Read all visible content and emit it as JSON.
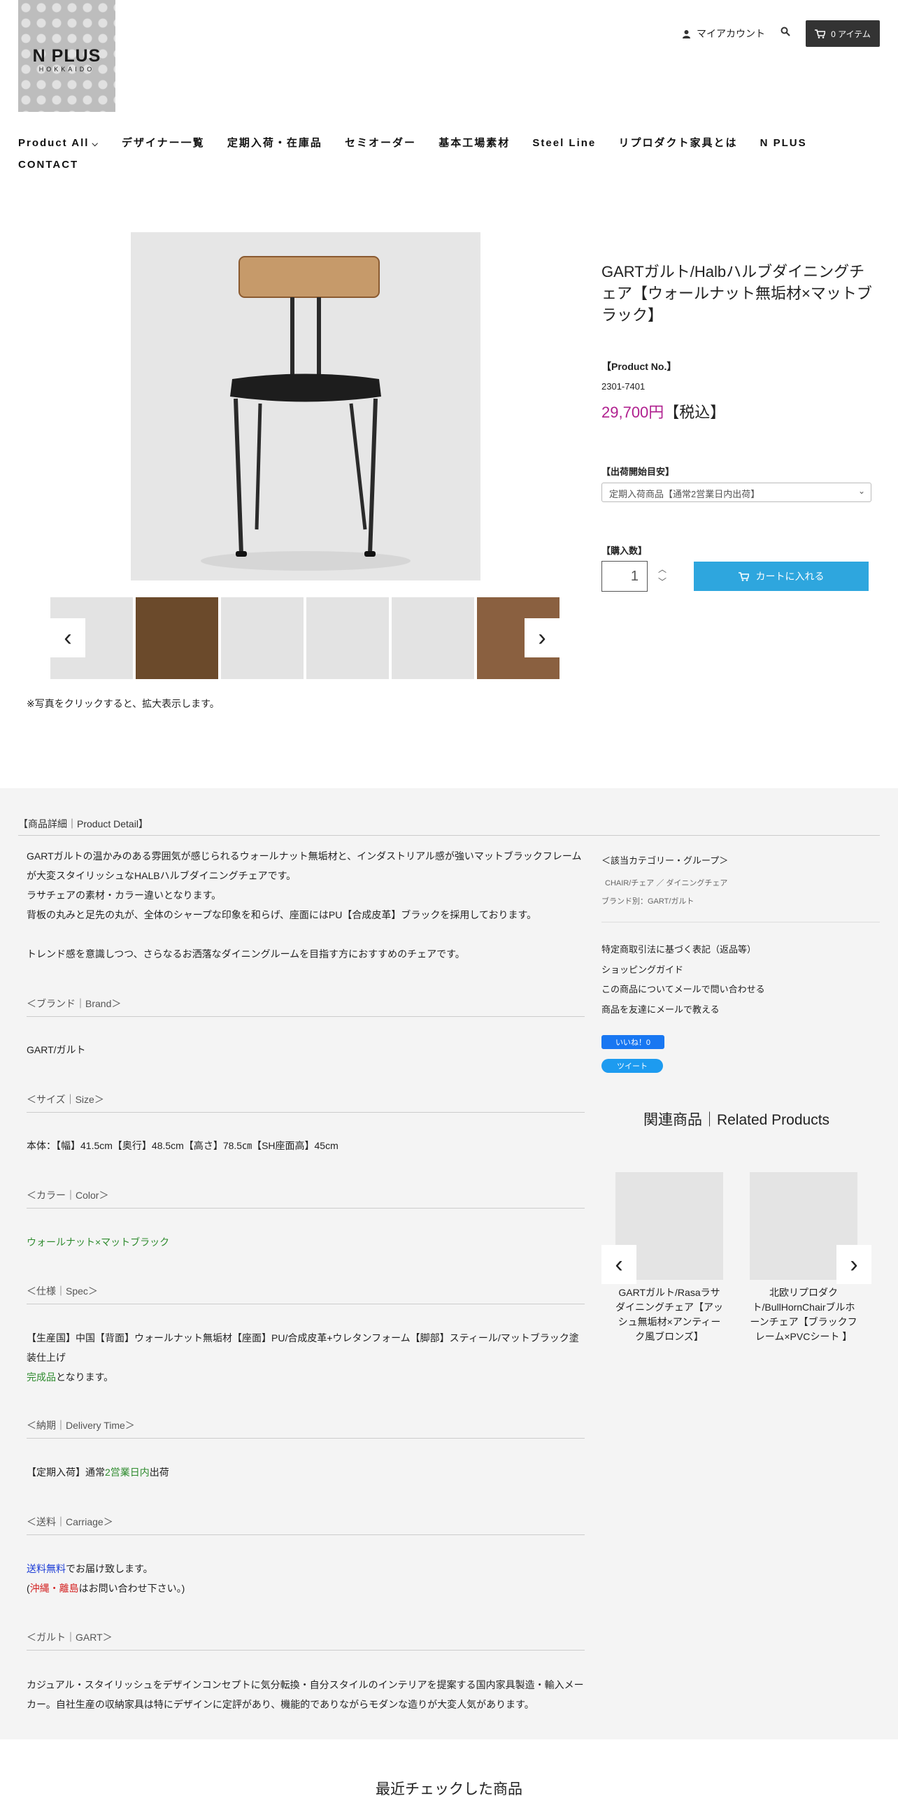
{
  "header": {
    "logo_text": "N PLUS",
    "logo_sub": "HOKKAIDO",
    "account_label": "マイアカウント",
    "cart_label": "0 アイテム"
  },
  "nav": {
    "items": [
      "Product All",
      "デザイナー一覧",
      "定期入荷・在庫品",
      "セミオーダー",
      "基本工場素材",
      "Steel Line",
      "リプロダクト家具とは",
      "N PLUS",
      "CONTACT"
    ]
  },
  "gallery": {
    "note": "※写真をクリックすると、拡大表示します。"
  },
  "product": {
    "title": "GARTガルト/Halbハルブダイニングチェア【ウォールナット無垢材×マットブラック】",
    "product_no_label": "【Product No.】",
    "product_no": "2301-7401",
    "price": "29,700円",
    "price_tax": "【税込】",
    "ship_label": "【出荷開始目安】",
    "ship_value": "定期入荷商品【通常2営業日内出荷】",
    "qty_label": "【購入数】",
    "qty_value": "1",
    "add_cart": "カートに入れる"
  },
  "detail": {
    "section_title": "【商品詳細｜Product Detail】",
    "intro": [
      "GARTガルトの温かみのある雰囲気が感じられるウォールナット無垢材と、インダストリアル感が強いマットブラックフレームが大変スタイリッシュなHALBハルブダイニングチェアです。",
      "ラサチェアの素材・カラー違いとなります。",
      "背板の丸みと足先の丸が、全体のシャープな印象を和らげ、座面にはPU【合成皮革】ブラックを採用しております。"
    ],
    "trend": "トレンド感を意識しつつ、さらなるお洒落なダイニングルームを目指す方におすすめのチェアです。",
    "brand_h": "＜ブランド｜Brand＞",
    "brand": "GART/ガルト",
    "size_h": "＜サイズ｜Size＞",
    "size": "本体：【幅】41.5cm【奥行】48.5cm【高さ】78.5㎝【SH座面高】45cm",
    "color_h": "＜カラー｜Color＞",
    "color": "ウォールナット×マットブラック",
    "spec_h": "＜仕様｜Spec＞",
    "spec": "【生産国】中国【背面】ウォールナット無垢材【座面】PU/合成皮革+ウレタンフォーム【脚部】スティール/マットブラック塗装仕上げ",
    "spec_green": "完成品",
    "spec_tail": "となります。",
    "delivery_h": "＜納期｜Delivery Time＞",
    "delivery_pre": "【定期入荷】通常",
    "delivery_green": "2営業日内",
    "delivery_post": "出荷",
    "carriage_h": "＜送料｜Carriage＞",
    "carriage_blue": "送料無料",
    "carriage_tail": "でお届け致します。",
    "carriage2_pre": "(",
    "carriage2_red": "沖縄・離島",
    "carriage2_post": "はお問い合わせ下さい。)",
    "gart_h": "＜ガルト｜GART＞",
    "gart": "カジュアル・スタイリッシュをデザインコンセプトに気分転換・自分スタイルのインテリアを提案する国内家具製造・輸入メーカー。自社生産の収納家具は特にデザインに定評があり、機能的でありながらモダンな造りが大変人気があります。"
  },
  "sidebar": {
    "category_h": "＜該当カテゴリー・グループ＞",
    "category": "CHAIR/チェア ／ ダイニングチェア",
    "brand_group": "ブランド別：GART/ガルト",
    "links": [
      "特定商取引法に基づく表記（返品等）",
      "ショッピングガイド",
      "この商品についてメールで問い合わせる",
      "商品を友達にメールで教える"
    ],
    "fb": "いいね！0",
    "tw": "ツイート"
  },
  "related": {
    "title": "関連商品｜Related Products",
    "items": [
      "GARTガルト/Rasaラサダイニングチェア【アッシュ無垢材×アンティーク風ブロンズ】",
      "北欧リプロダクト/BullHornChairブルホーンチェア【ブラックフレーム×PVCシート 】"
    ]
  },
  "recent": {
    "title": "最近チェックした商品"
  },
  "colors": {
    "accent": "#2ea6de",
    "price": "#b0208f",
    "green": "#2e8b2e"
  }
}
